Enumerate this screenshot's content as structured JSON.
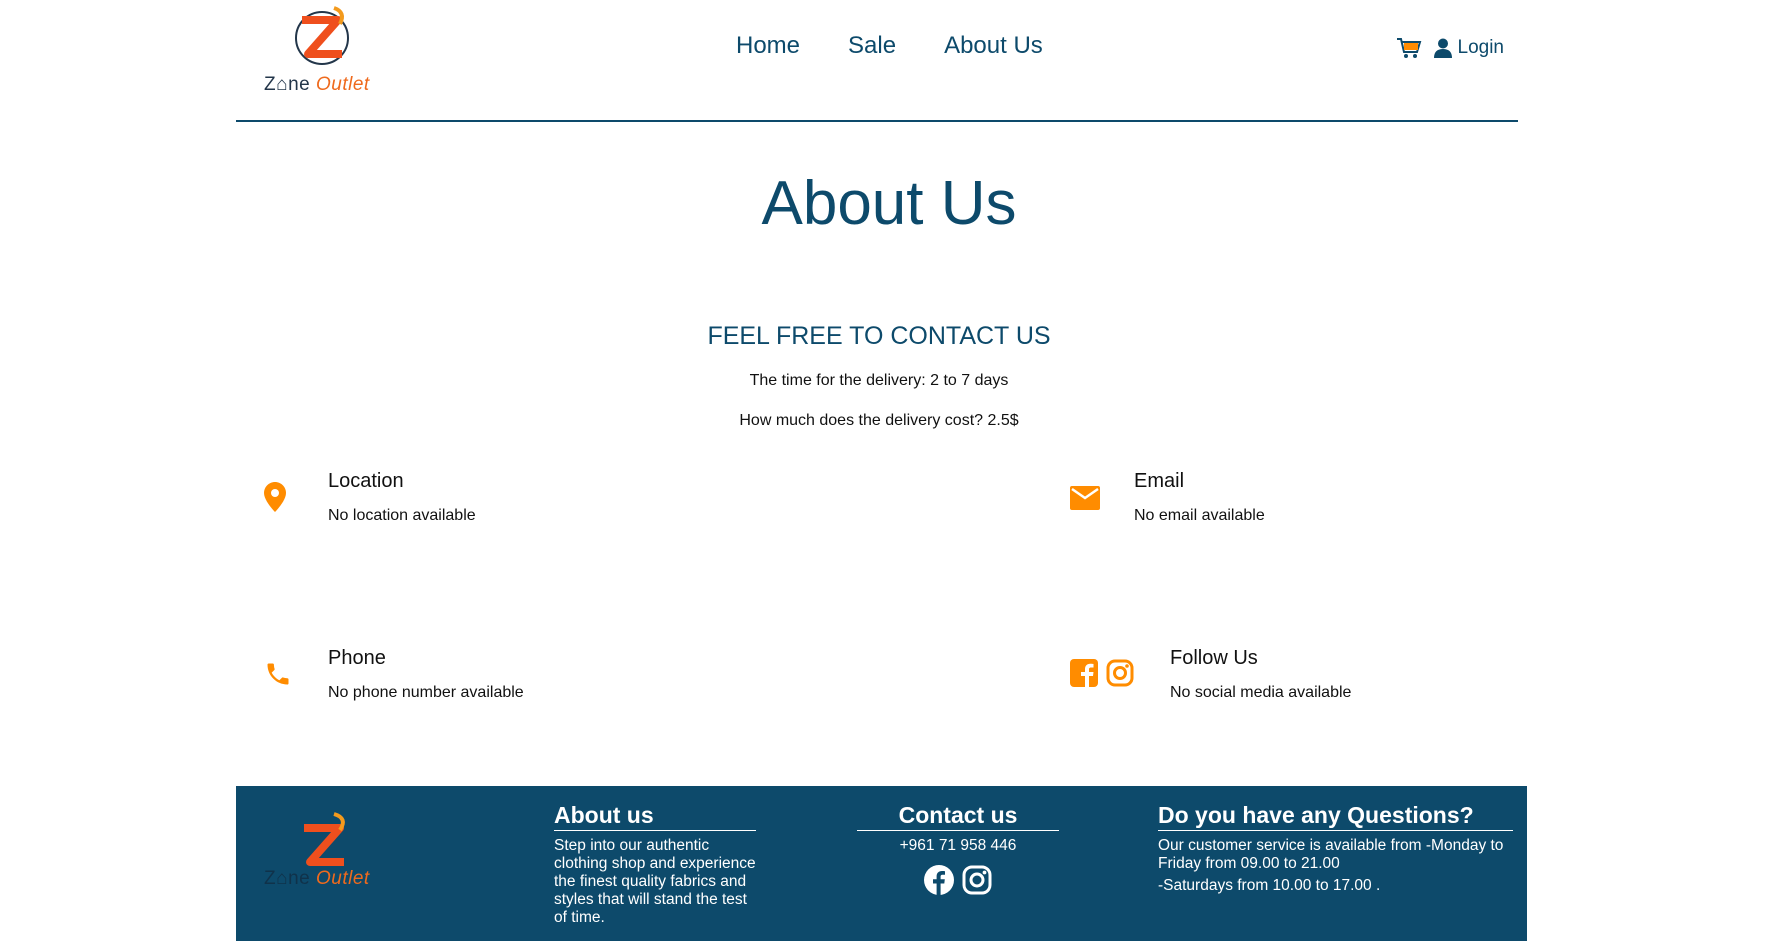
{
  "brand": {
    "logo_letters": "Z",
    "name_part1": "Z⌂ne",
    "name_part2": "Outlet"
  },
  "nav": {
    "home": "Home",
    "sale": "Sale",
    "about": "About Us"
  },
  "header": {
    "cart_icon": "cart-icon",
    "user_icon": "user-icon",
    "login": "Login"
  },
  "page": {
    "title": "About Us",
    "contact_heading": "FEEL FREE TO CONTACT US",
    "delivery_time": "The time for the delivery: 2 to 7 days",
    "delivery_cost": "How much does the delivery cost? 2.5$"
  },
  "cards": {
    "location": {
      "title": "Location",
      "value": "No location available",
      "icon": "map-pin-icon"
    },
    "email": {
      "title": "Email",
      "value": "No email available",
      "icon": "envelope-icon"
    },
    "phone": {
      "title": "Phone",
      "value": "No phone number available",
      "icon": "phone-icon"
    },
    "follow": {
      "title": "Follow Us",
      "value": "No social media available",
      "icons": [
        "facebook-icon",
        "instagram-icon"
      ]
    }
  },
  "footer": {
    "about_heading": "About us",
    "about_text": "Step into our authentic clothing shop and experience the finest quality fabrics and styles that will stand the test of time.",
    "contact_heading": "Contact us",
    "phone": "+961 71 958 446",
    "questions_heading": "Do you have any Questions?",
    "hours_weekdays": "Our customer service is available from -Monday to Friday from 09.00 to 21.00",
    "hours_saturday": "-Saturdays from 10.00 to 17.00 ."
  },
  "colors": {
    "primary": "#0d4a6b",
    "accent": "#ff8c00",
    "brand_orange": "#ef6a1d"
  }
}
